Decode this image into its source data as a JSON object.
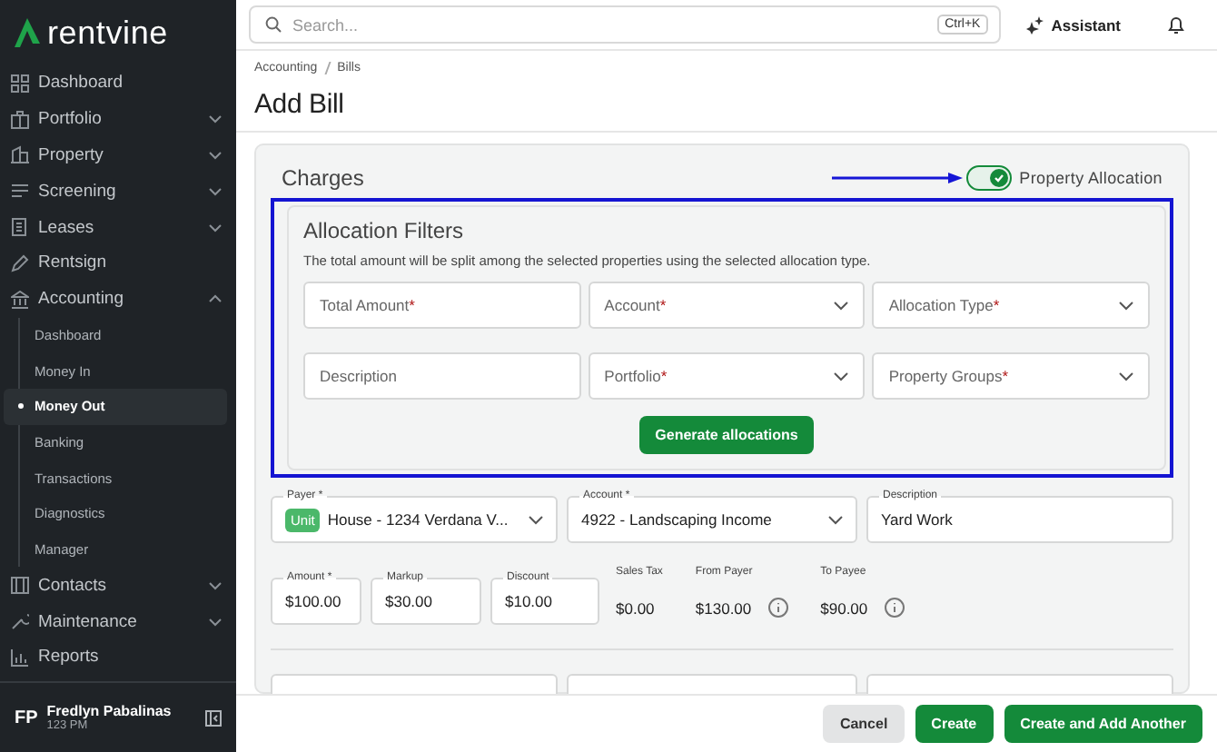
{
  "logo": "rentvine",
  "sidebar": {
    "items": [
      {
        "label": "Dashboard",
        "expandable": false
      },
      {
        "label": "Portfolio",
        "expandable": true,
        "expanded": false
      },
      {
        "label": "Property",
        "expandable": true,
        "expanded": false
      },
      {
        "label": "Screening",
        "expandable": true,
        "expanded": false
      },
      {
        "label": "Leases",
        "expandable": true,
        "expanded": false
      },
      {
        "label": "Rentsign",
        "expandable": false
      },
      {
        "label": "Accounting",
        "expandable": true,
        "expanded": true,
        "children": [
          {
            "label": "Dashboard",
            "selected": false
          },
          {
            "label": "Money In",
            "selected": false
          },
          {
            "label": "Money Out",
            "selected": true
          },
          {
            "label": "Banking",
            "selected": false
          },
          {
            "label": "Transactions",
            "selected": false
          },
          {
            "label": "Diagnostics",
            "selected": false
          },
          {
            "label": "Manager",
            "selected": false
          }
        ]
      },
      {
        "label": "Contacts",
        "expandable": true,
        "expanded": false
      },
      {
        "label": "Maintenance",
        "expandable": true,
        "expanded": false
      },
      {
        "label": "Reports",
        "expandable": false
      }
    ],
    "user": {
      "initials": "FP",
      "name": "Fredlyn Pabalinas",
      "time": "123 PM"
    }
  },
  "topbar": {
    "search_placeholder": "Search...",
    "shortcut": "Ctrl+K",
    "assistant": "Assistant"
  },
  "breadcrumb": [
    "Accounting",
    "Bills"
  ],
  "title": "Add Bill",
  "charges": {
    "title": "Charges",
    "toggle": {
      "label": "Property Allocation",
      "on": true
    },
    "allocation_filters": {
      "title": "Allocation Filters",
      "description": "The total amount will be split among the selected properties using the selected allocation type.",
      "fields": [
        {
          "placeholder": "Total Amount",
          "required_mark": "*",
          "kind": "input"
        },
        {
          "placeholder": "Account",
          "required_mark": "*",
          "kind": "select"
        },
        {
          "placeholder": "Allocation Type",
          "required_mark": "*",
          "kind": "select"
        },
        {
          "placeholder": "Description",
          "kind": "input"
        },
        {
          "placeholder": "Portfolio",
          "required_mark": "*",
          "kind": "select"
        },
        {
          "placeholder": "Property Groups",
          "required_mark": "*",
          "kind": "select"
        }
      ],
      "button": "Generate allocations"
    },
    "line": {
      "fields": [
        {
          "label": "Payer *",
          "badge": "Unit",
          "value": "House - 1234 Verdana V...",
          "kind": "select"
        },
        {
          "label": "Account *",
          "value": "4922 - Landscaping Income",
          "kind": "select"
        },
        {
          "label": "Description",
          "value": "Yard Work",
          "kind": "input"
        }
      ],
      "amounts": [
        {
          "label": "Amount *",
          "value": "$100.00",
          "kind": "input"
        },
        {
          "label": "Markup",
          "value": "$30.00",
          "kind": "input"
        },
        {
          "label": "Discount",
          "value": "$10.00",
          "kind": "input"
        },
        {
          "label": "Sales Tax",
          "value": "$0.00",
          "kind": "text",
          "info": false
        },
        {
          "label": "From Payer",
          "value": "$130.00",
          "kind": "text",
          "info": true
        },
        {
          "label": "To Payee",
          "value": "$90.00",
          "kind": "text",
          "info": true
        }
      ]
    }
  },
  "footer": {
    "buttons": [
      {
        "label": "Cancel",
        "kind": "secondary"
      },
      {
        "label": "Create",
        "kind": "primary"
      },
      {
        "label": "Create and Add Another",
        "kind": "primary"
      }
    ]
  }
}
